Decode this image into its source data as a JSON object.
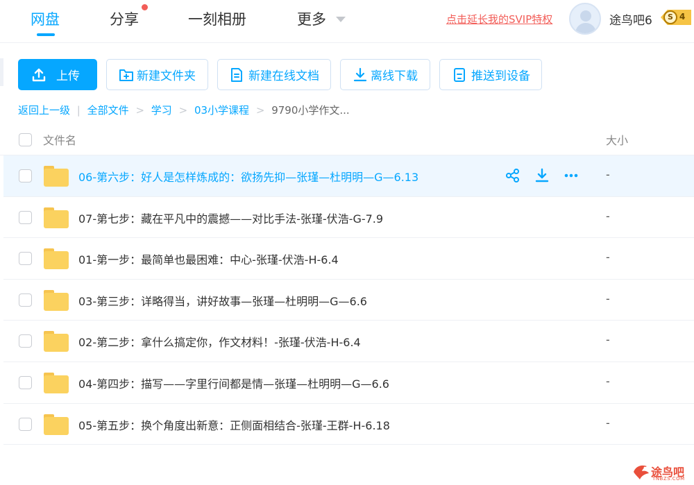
{
  "nav": {
    "tabs": [
      "网盘",
      "分享",
      "一刻相册",
      "更多"
    ],
    "svip_link": "点击延长我的SVIP特权",
    "username": "途鸟吧6",
    "badge_symbol": "S",
    "badge_level": "4"
  },
  "toolbar": {
    "upload": "上传",
    "new_folder": "新建文件夹",
    "new_doc": "新建在线文档",
    "offline_download": "离线下载",
    "push_device": "推送到设备"
  },
  "breadcrumb": {
    "back": "返回上一级",
    "all_files": "全部文件",
    "crumbs": [
      "学习",
      "03小学课程"
    ],
    "current": "9790小学作文..."
  },
  "table": {
    "col_name": "文件名",
    "col_size": "大小",
    "rows": [
      {
        "name": "06-第六步：好人是怎样炼成的：欲扬先抑—张瑾—杜明明—G—6.13",
        "size": "-"
      },
      {
        "name": "07-第七步：藏在平凡中的震撼——对比手法-张瑾-伏浩-G-7.9",
        "size": "-"
      },
      {
        "name": "01-第一步：最简单也最困难：中心-张瑾-伏浩-H-6.4",
        "size": "-"
      },
      {
        "name": "03-第三步：详略得当，讲好故事—张瑾—杜明明—G—6.6",
        "size": "-"
      },
      {
        "name": "02-第二步：拿什么搞定你，作文材料！-张瑾-伏浩-H-6.4",
        "size": "-"
      },
      {
        "name": "04-第四步：描写——字里行间都是情—张瑾—杜明明—G—6.6",
        "size": "-"
      },
      {
        "name": "05-第五步：换个角度出新意：正侧面相结合-张瑾-王群-H-6.18",
        "size": "-"
      }
    ]
  },
  "watermark": {
    "text": "途鸟吧",
    "sub": "TNBZS.COM"
  },
  "colors": {
    "accent": "#06a7ff",
    "svip": "#f25d58",
    "folder": "#fbd25f"
  }
}
